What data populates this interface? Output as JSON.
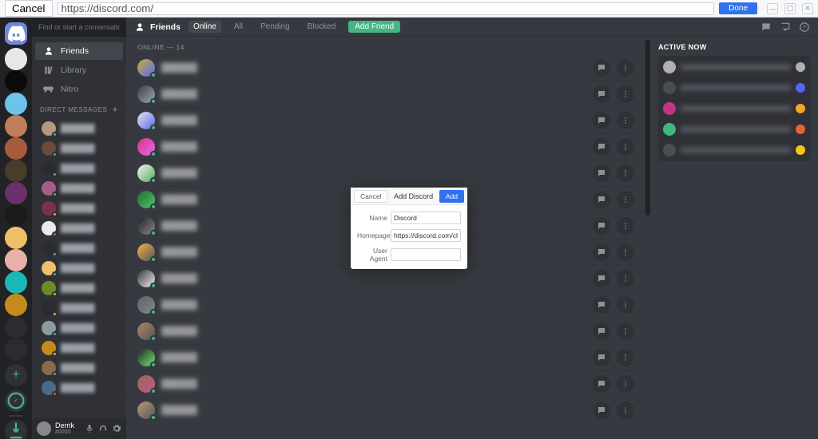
{
  "host": {
    "cancel": "Cancel",
    "url": "https://discord.com/",
    "done": "Done"
  },
  "sidebar": {
    "search_placeholder": "Find or start a conversation",
    "items": [
      {
        "label": "Friends"
      },
      {
        "label": "Library"
      },
      {
        "label": "Nitro"
      }
    ],
    "dm_header": "DIRECT MESSAGES"
  },
  "user_panel": {
    "name": "Derrik",
    "discrim": "#0000"
  },
  "header": {
    "title": "Friends",
    "tabs": {
      "online": "Online",
      "all": "All",
      "pending": "Pending",
      "blocked": "Blocked",
      "add": "Add Friend"
    }
  },
  "online_count": "ONLINE — 14",
  "friend_colors": [
    [
      "#c9b037",
      "#5865f2"
    ],
    [
      "#3a3c40",
      "#99aab5"
    ],
    [
      "#e8e8e8",
      "#5865f2"
    ],
    [
      "#d63384",
      "#e86af0"
    ],
    [
      "#f5f5f5",
      "#5a5"
    ],
    [
      "#1b6e2f",
      "#56c271"
    ],
    [
      "#202124",
      "#888"
    ],
    [
      "#f2b34c",
      "#555"
    ],
    [
      "#34363c",
      "#eee"
    ],
    [
      "#5a6268",
      "#888"
    ],
    [
      "#ad8866",
      "#555"
    ],
    [
      "#212326",
      "#6fe86f"
    ],
    [
      "#8e6c5a",
      "#c58"
    ],
    [
      "#b89a7a",
      "#555"
    ]
  ],
  "status_colors": {
    "online": "#43b581",
    "idle": "#faa61a",
    "dnd": "#f04747"
  },
  "active_now": {
    "title": "ACTIVE NOW",
    "rows": [
      {
        "av": "#b0b0b0",
        "dot": "#b0b0b0"
      },
      {
        "av": "#4a4d52",
        "dot": "#5865f2"
      },
      {
        "av": "#c13584",
        "dot": "#f5a623"
      },
      {
        "av": "#43b581",
        "dot": "#e8603c"
      },
      {
        "av": "#4a4d52",
        "dot": "#f5c518"
      }
    ]
  },
  "modal": {
    "cancel": "Cancel",
    "title": "Add  Discord",
    "add": "Add",
    "name_label": "Name",
    "name_value": "Discord",
    "homepage_label": "Homepage",
    "homepage_value": "https://discord.com/channels/@me",
    "useragent_label": "User Agent",
    "useragent_value": ""
  },
  "guild_colors": [
    "#e8e8e8",
    "#0b0b0b",
    "#6cc4e8",
    "#c17c5b",
    "#a85c3c",
    "#4a3c2a",
    "#6b2f6b",
    "#1b1b1b",
    "#efbf6a",
    "#e8b0a8",
    "#1bb6b6",
    "#c58a1b",
    "#2a2c30",
    "#2a2c30"
  ],
  "dm_items": [
    [
      "#b39a7a",
      "online"
    ],
    [
      "#6b4a3a",
      "online"
    ],
    [
      "#2a2c30",
      "online"
    ],
    [
      "#a85c89",
      "online"
    ],
    [
      "#7a324a",
      "idle"
    ],
    [
      "#eaeaea",
      "dnd"
    ],
    [
      "#2a2c30",
      "online"
    ],
    [
      "#efbf6a",
      "online"
    ],
    [
      "#6b8e23",
      "idle"
    ],
    [
      "#2a2c30",
      "idle"
    ],
    [
      "#8e9aa0",
      "online"
    ],
    [
      "#c58a1b",
      "idle"
    ],
    [
      "#8a6a4a",
      "online"
    ],
    [
      "#4a6a8a",
      "dnd"
    ]
  ]
}
